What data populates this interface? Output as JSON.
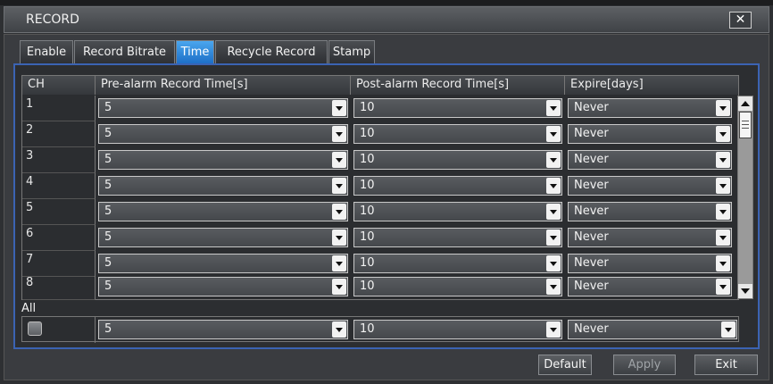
{
  "window": {
    "title": "RECORD",
    "close_label": "✕"
  },
  "tabs": [
    {
      "label": "Enable",
      "active": false
    },
    {
      "label": "Record Bitrate",
      "active": false
    },
    {
      "label": "Time",
      "active": true
    },
    {
      "label": "Recycle Record",
      "active": false
    },
    {
      "label": "Stamp",
      "active": false
    }
  ],
  "table": {
    "headers": [
      "CH",
      "Pre-alarm Record Time[s]",
      "Post-alarm Record Time[s]",
      "Expire[days]"
    ],
    "rows": [
      {
        "ch": "1",
        "pre": "5",
        "post": "10",
        "expire": "Never"
      },
      {
        "ch": "2",
        "pre": "5",
        "post": "10",
        "expire": "Never"
      },
      {
        "ch": "3",
        "pre": "5",
        "post": "10",
        "expire": "Never"
      },
      {
        "ch": "4",
        "pre": "5",
        "post": "10",
        "expire": "Never"
      },
      {
        "ch": "5",
        "pre": "5",
        "post": "10",
        "expire": "Never"
      },
      {
        "ch": "6",
        "pre": "5",
        "post": "10",
        "expire": "Never"
      },
      {
        "ch": "7",
        "pre": "5",
        "post": "10",
        "expire": "Never"
      },
      {
        "ch": "8",
        "pre": "5",
        "post": "10",
        "expire": "Never"
      }
    ]
  },
  "all": {
    "label": "All",
    "pre": "5",
    "post": "10",
    "expire": "Never",
    "checked": false
  },
  "buttons": {
    "default": "Default",
    "apply": "Apply",
    "exit": "Exit"
  },
  "colors": {
    "active_tab": "#2a86de",
    "panel_border": "#3b63b3"
  }
}
